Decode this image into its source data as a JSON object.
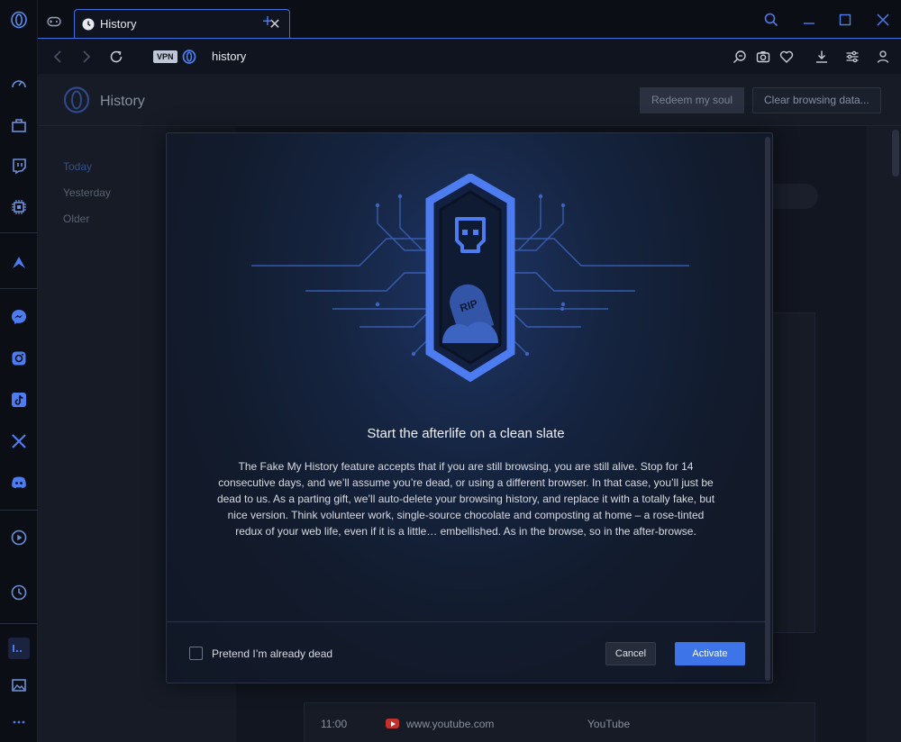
{
  "colors": {
    "accent": "#3d74e8",
    "background": "#0b0e15",
    "surface": "#161b26"
  },
  "tab": {
    "title": "History",
    "icon": "clock-icon"
  },
  "address": {
    "vpn_label": "VPN",
    "url": "history"
  },
  "page": {
    "title": "History",
    "redeem_label": "Redeem my soul",
    "clear_label": "Clear browsing data...",
    "nav": [
      "Today",
      "Yesterday",
      "Older"
    ]
  },
  "history": [
    {
      "time": "11:00",
      "site": "www.youtube.com",
      "title": "YouTube"
    }
  ],
  "modal": {
    "title": "Start the afterlife on a clean slate",
    "body": "The Fake My History feature accepts that if you are still browsing, you are still alive. Stop for 14 consecutive days, and we’ll assume you’re dead, or using a different browser. In that case, you’ll just be dead to us. As a parting gift, we’ll auto-delete your browsing history, and replace it with a totally fake, but nice version. Think volunteer work, single-source chocolate and composting at home – a rose-tinted redux of your web life, even if it is a little… embellished. As in the browse, so in the after-browse.",
    "rip_label": "RIP",
    "checkbox_label": "Pretend I’m already dead",
    "cancel_label": "Cancel",
    "activate_label": "Activate"
  }
}
